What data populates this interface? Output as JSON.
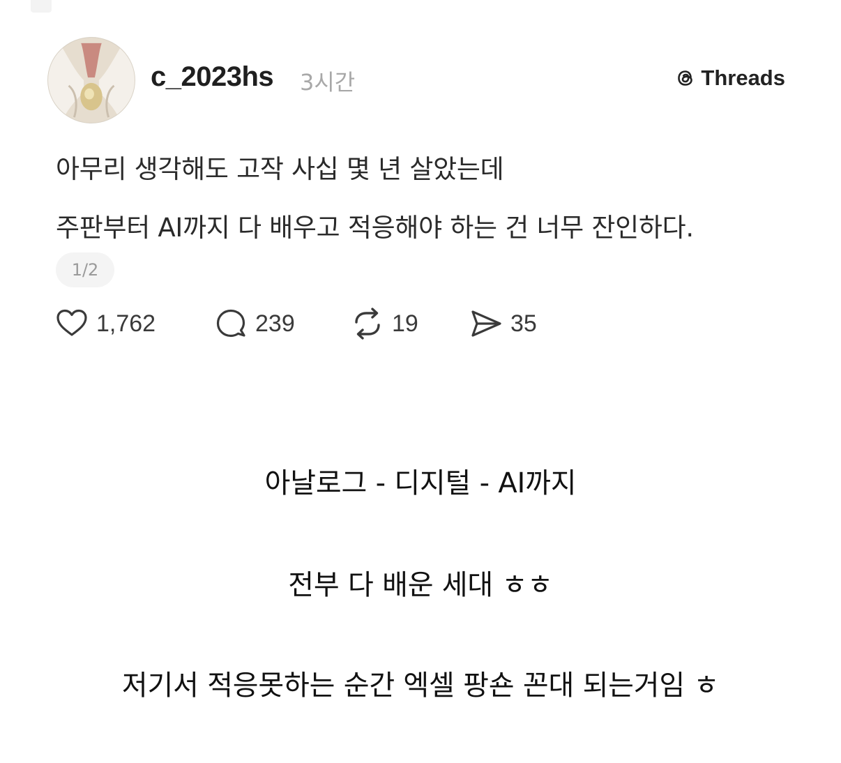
{
  "post": {
    "username": "c_2023hs",
    "timestamp": "3시간",
    "brand": "Threads",
    "text_lines": [
      "아무리 생각해도 고작 사십 몇 년 살았는데",
      "주판부터 AI까지 다 배우고 적응해야 하는 건 너무 잔인하다."
    ],
    "page_indicator": "1/2",
    "actions": {
      "likes": "1,762",
      "replies": "239",
      "reposts": "19",
      "shares": "35"
    }
  },
  "captions": [
    "아날로그 - 디지털 - AI까지",
    "전부 다 배운 세대 ㅎㅎ",
    "저기서 적응못하는 순간 엑셀 팡숀 꼰대 되는거임 ㅎ"
  ],
  "icons": {
    "brand": "threads-logo-icon",
    "like": "heart-icon",
    "reply": "comment-bubble-icon",
    "repost": "repost-arrows-icon",
    "share": "send-icon"
  },
  "colors": {
    "text_primary": "#1f1f1f",
    "text_muted": "#a8a8a8",
    "background": "#ffffff"
  }
}
